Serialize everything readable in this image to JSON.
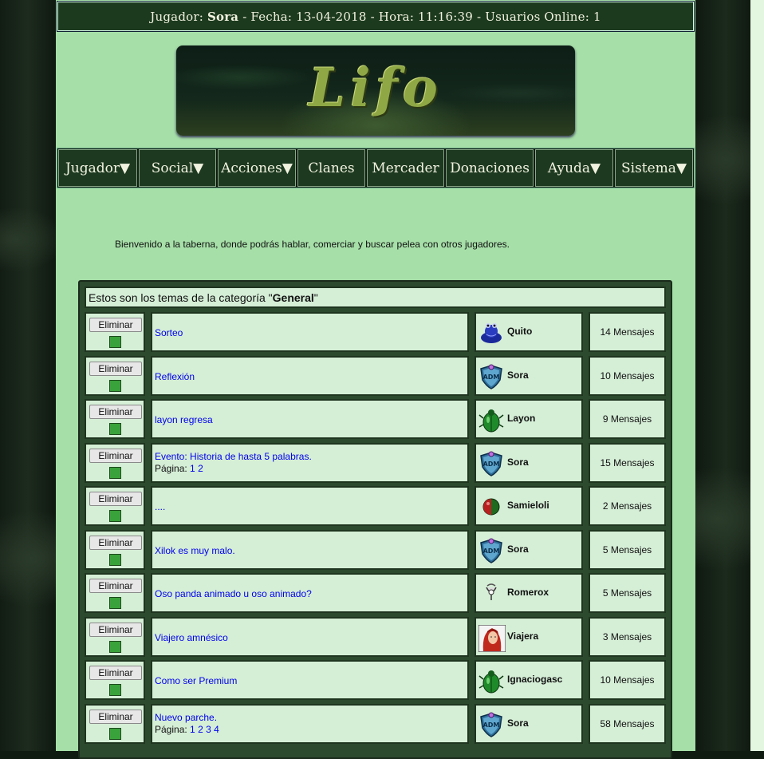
{
  "topbar": {
    "jugador_label": "Jugador:",
    "jugador_name": "Sora",
    "fecha_text": "- Fecha: 13-04-2018 - Hora: 11:16:39 - Usuarios Online: 1"
  },
  "banner": {
    "logo_text": "Lifo"
  },
  "nav": {
    "items": [
      "Jugador▼",
      "Social▼",
      "Acciones▼",
      "Clanes",
      "Mercader",
      "Donaciones",
      "Ayuda▼",
      "Sistema▼"
    ]
  },
  "welcome": "Bienvenido a la taberna, donde podrás hablar, comerciar y buscar pelea con otros jugadores.",
  "category": {
    "prefix": "Estos son los temas de la categoría \"",
    "name": "General",
    "suffix": "\""
  },
  "delete_label": "Eliminar",
  "pages_label": "Página:",
  "topics": [
    {
      "title": "Sorteo",
      "user": "Quito",
      "avatar": "blue-creature-icon",
      "msgs": "14 Mensajes",
      "pages": []
    },
    {
      "title": "Reflexión",
      "user": "Sora",
      "avatar": "adm-shield-icon",
      "msgs": "10 Mensajes",
      "pages": []
    },
    {
      "title": "layon regresa",
      "user": "Layon",
      "avatar": "green-beetle-icon",
      "msgs": "9 Mensajes",
      "pages": []
    },
    {
      "title": "Evento: Historia de hasta 5 palabras.",
      "user": "Sora",
      "avatar": "adm-shield-icon",
      "msgs": "15 Mensajes",
      "pages": [
        "1",
        "2"
      ]
    },
    {
      "title": "....",
      "user": "Samieloli",
      "avatar": "red-green-orb-icon",
      "msgs": "2 Mensajes",
      "pages": []
    },
    {
      "title": "Xilok es muy malo.",
      "user": "Sora",
      "avatar": "adm-shield-icon",
      "msgs": "5 Mensajes",
      "pages": []
    },
    {
      "title": "Oso panda animado u oso animado?",
      "user": "Romerox",
      "avatar": "key-amulet-icon",
      "msgs": "5 Mensajes",
      "pages": []
    },
    {
      "title": "Viajero amnésico",
      "user": "Viajera",
      "avatar": "red-hair-portrait-icon",
      "msgs": "3 Mensajes",
      "pages": []
    },
    {
      "title": "Como ser Premium",
      "user": "Ignaciogasc",
      "avatar": "green-beetle-icon",
      "msgs": "10 Mensajes",
      "pages": []
    },
    {
      "title": "Nuevo parche.",
      "user": "Sora",
      "avatar": "adm-shield-icon",
      "msgs": "58 Mensajes",
      "pages": [
        "1",
        "2",
        "3",
        "4"
      ]
    }
  ]
}
